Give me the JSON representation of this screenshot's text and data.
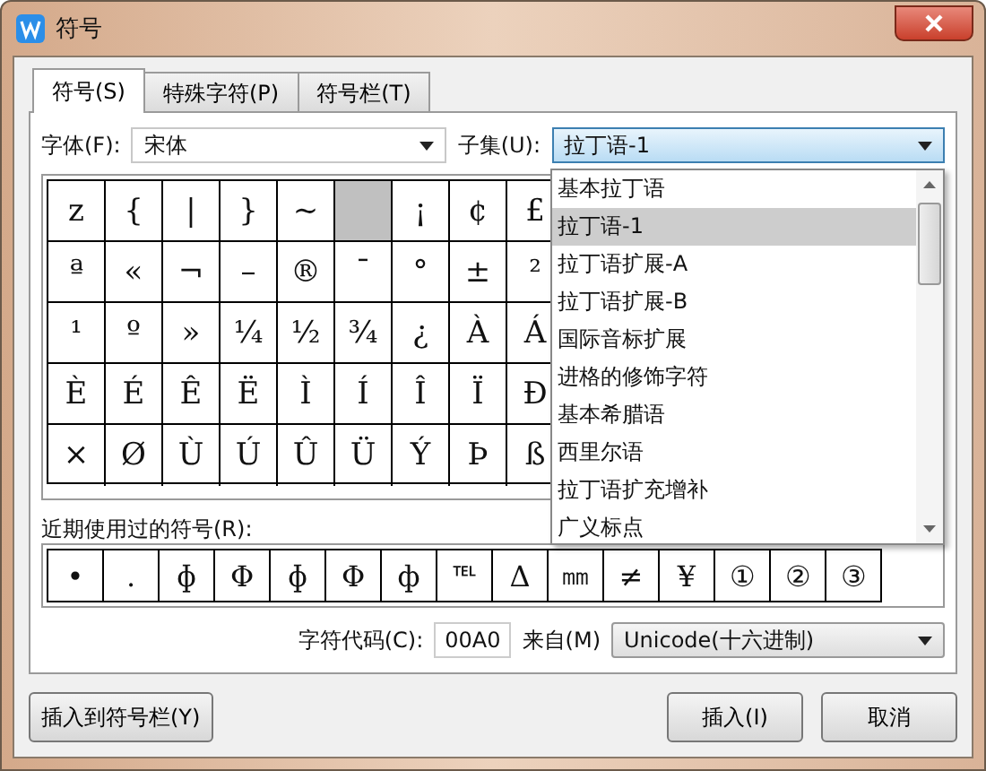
{
  "window": {
    "title": "符号"
  },
  "tabs": [
    {
      "label": "符号(S)",
      "selected": true
    },
    {
      "label": "特殊字符(P)",
      "selected": false
    },
    {
      "label": "符号栏(T)",
      "selected": false
    }
  ],
  "font": {
    "label": "字体(F):",
    "value": "宋体"
  },
  "subset": {
    "label": "子集(U):",
    "value": "拉丁语-1",
    "expanded": true,
    "options": [
      {
        "label": "基本拉丁语",
        "selected": false
      },
      {
        "label": "拉丁语-1",
        "selected": true
      },
      {
        "label": "拉丁语扩展-A",
        "selected": false
      },
      {
        "label": "拉丁语扩展-B",
        "selected": false
      },
      {
        "label": "国际音标扩展",
        "selected": false
      },
      {
        "label": "进格的修饰字符",
        "selected": false
      },
      {
        "label": "基本希腊语",
        "selected": false
      },
      {
        "label": "西里尔语",
        "selected": false
      },
      {
        "label": "拉丁语扩充增补",
        "selected": false
      },
      {
        "label": "广义标点",
        "selected": false
      }
    ]
  },
  "symbol_grid": [
    [
      {
        "char": "z",
        "selected": false
      },
      {
        "char": "{",
        "selected": false
      },
      {
        "char": "|",
        "selected": false
      },
      {
        "char": "}",
        "selected": false
      },
      {
        "char": "~",
        "selected": false
      },
      {
        "selected": true
      },
      {
        "char": "¡",
        "selected": false
      },
      {
        "char": "¢",
        "selected": false
      },
      {
        "char": "£",
        "selected": false
      }
    ],
    [
      {
        "char": "ª",
        "selected": false
      },
      {
        "char": "«",
        "selected": false
      },
      {
        "char": "¬",
        "selected": false
      },
      {
        "char": "–",
        "selected": false
      },
      {
        "char": "®",
        "selected": false
      },
      {
        "char": "¯",
        "selected": false
      },
      {
        "char": "°",
        "selected": false
      },
      {
        "char": "±",
        "selected": false
      },
      {
        "char": "²",
        "selected": false
      }
    ],
    [
      {
        "char": "¹",
        "selected": false
      },
      {
        "char": "º",
        "selected": false
      },
      {
        "char": "»",
        "selected": false
      },
      {
        "char": "¼",
        "selected": false
      },
      {
        "char": "½",
        "selected": false
      },
      {
        "char": "¾",
        "selected": false
      },
      {
        "char": "¿",
        "selected": false
      },
      {
        "char": "À",
        "selected": false
      },
      {
        "char": "Á",
        "selected": false
      }
    ],
    [
      {
        "char": "È",
        "selected": false
      },
      {
        "char": "É",
        "selected": false
      },
      {
        "char": "Ê",
        "selected": false
      },
      {
        "char": "Ë",
        "selected": false
      },
      {
        "char": "Ì",
        "selected": false
      },
      {
        "char": "Í",
        "selected": false
      },
      {
        "char": "Î",
        "selected": false
      },
      {
        "char": "Ï",
        "selected": false
      },
      {
        "char": "Ð",
        "selected": false
      }
    ],
    [
      {
        "char": "×",
        "selected": false
      },
      {
        "char": "Ø",
        "selected": false
      },
      {
        "char": "Ù",
        "selected": false
      },
      {
        "char": "Ú",
        "selected": false
      },
      {
        "char": "Û",
        "selected": false
      },
      {
        "char": "Ü",
        "selected": false
      },
      {
        "char": "Ý",
        "selected": false
      },
      {
        "char": "Þ",
        "selected": false
      },
      {
        "char": "ß",
        "selected": false
      }
    ]
  ],
  "recent": {
    "label": "近期使用过的符号(R):",
    "symbols": [
      "•",
      ".",
      "ɸ",
      "Φ",
      "ɸ",
      "Φ",
      "ф",
      "℡",
      "Δ",
      "㎜",
      "≠",
      "¥",
      "①",
      "②",
      "③"
    ]
  },
  "char_code": {
    "label": "字符代码(C):",
    "value": "00A0"
  },
  "from": {
    "label": "来自(M)",
    "value": "Unicode(十六进制)"
  },
  "buttons": [
    {
      "label": "插入到符号栏(Y)",
      "kind": "left"
    },
    {
      "label": "插入(I)",
      "kind": "right"
    },
    {
      "label": "取消",
      "kind": "right"
    }
  ]
}
